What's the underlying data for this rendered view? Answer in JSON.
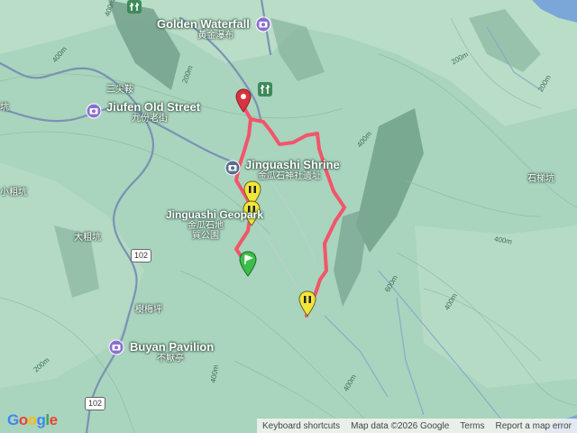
{
  "map": {
    "pois": [
      {
        "title": "Golden Waterfall",
        "sub": "黃金瀑布"
      },
      {
        "title": "Jiufen Old Street",
        "sub": "九份老街"
      },
      {
        "title": "Jinguashi Shrine",
        "sub": "金瓜石神社遺址"
      },
      {
        "title": "Jinguashi Geopark",
        "sub": "金瓜石地質公園"
      },
      {
        "title": "Buyan Pavilion",
        "sub": "不厭亭"
      }
    ],
    "places": [
      "三尖鞍",
      "小粗坑",
      "大粗坑",
      "樹梅坪",
      "石梯坑",
      "坑"
    ],
    "roads": [
      "102",
      "102"
    ],
    "contours": [
      "400m",
      "200m",
      "200m",
      "400m",
      "400m",
      "600m",
      "400m",
      "400m",
      "400m",
      "400m",
      "200m",
      "200m"
    ]
  },
  "attribution": {
    "logo": "Google",
    "keyboard": "Keyboard shortcuts",
    "mapdata": "Map data ©2026 Google",
    "terms": "Terms",
    "report": "Report a map error"
  },
  "colors": {
    "terrain": "#a9d4bd",
    "trail": "#f2556a",
    "road": "#7a92b4",
    "marker_red": "#d9333f",
    "marker_yellow": "#f3e63b",
    "marker_green": "#3bbf4a"
  }
}
